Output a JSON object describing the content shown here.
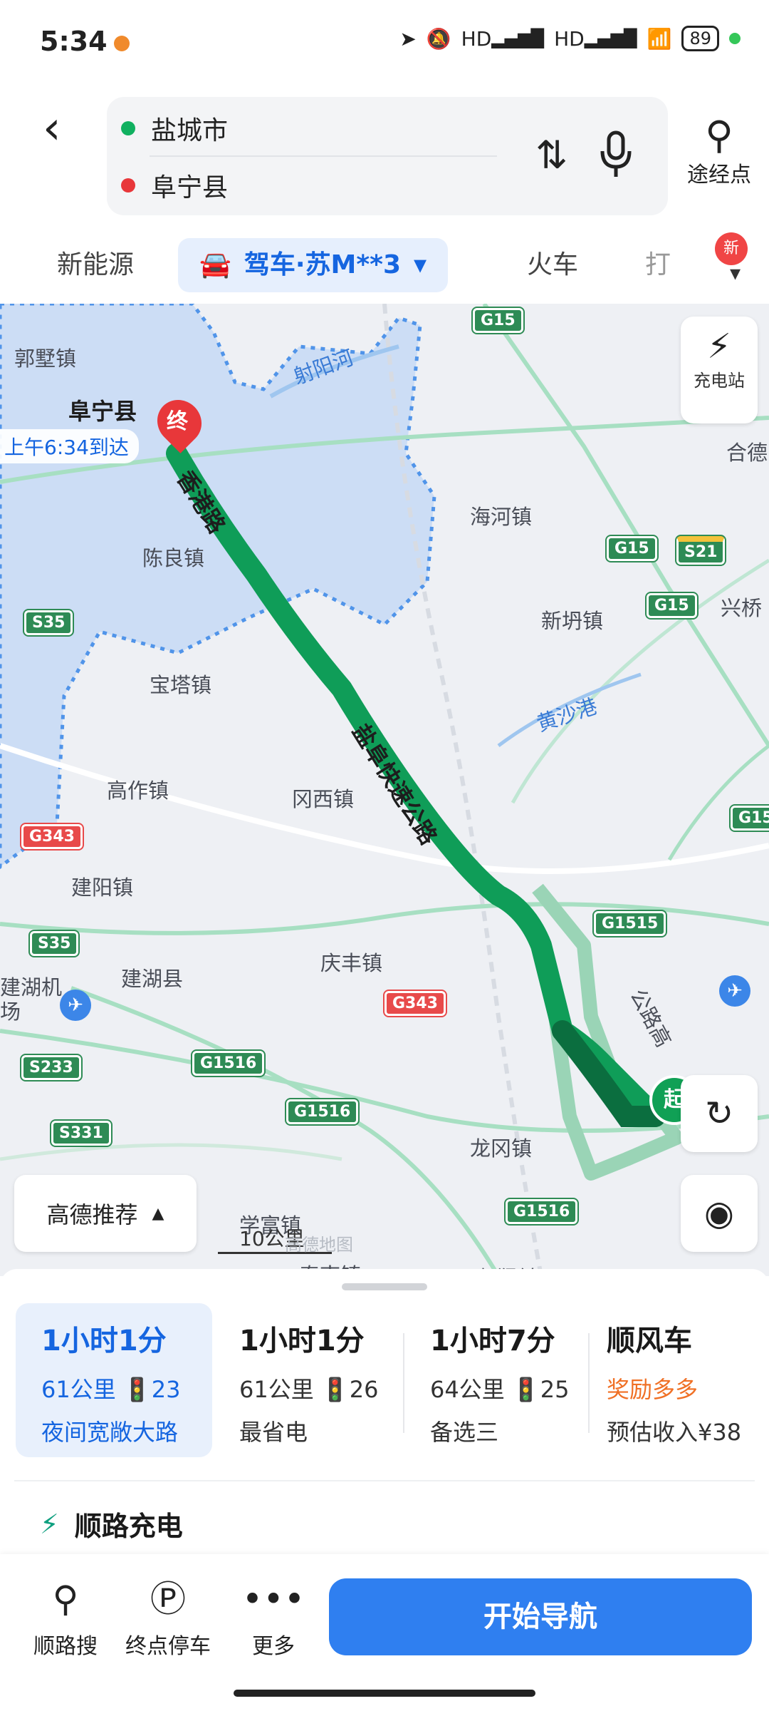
{
  "status_bar": {
    "time": "5:34",
    "battery": "89",
    "signal_labels": [
      "HD",
      "HD"
    ]
  },
  "search": {
    "origin": "盐城市",
    "destination": "阜宁县",
    "waypoint_label": "途经点"
  },
  "modes": {
    "new_energy": "新能源",
    "drive": "驾车·苏M**3",
    "train": "火车",
    "taxi": "打",
    "badge": "新"
  },
  "colors": {
    "accent": "#1565e0",
    "route": "#10a055",
    "origin_dot": "#10b060",
    "destination_dot": "#e8373a",
    "button": "#2f7ff0"
  },
  "map": {
    "destination_name": "阜宁县",
    "arrival": "上午6:34到达",
    "end_pin": "终",
    "start_pin": "起",
    "places": [
      "郭墅镇",
      "陈良镇",
      "海河镇",
      "新坍镇",
      "兴桥",
      "合德",
      "宝塔镇",
      "高作镇",
      "冈西镇",
      "建阳镇",
      "建湖县",
      "庆丰镇",
      "龙冈镇",
      "学富镇",
      "秦南镇",
      "郭猛镇"
    ],
    "airport_label": "建湖机场",
    "rivers": [
      "射阳河",
      "黄沙港"
    ],
    "roads": [
      "香港路",
      "盐阜快速公路",
      "公路高"
    ],
    "shields": [
      "G15",
      "G15",
      "G15",
      "S21",
      "G15",
      "S35",
      "G343",
      "S35",
      "G1515",
      "G343",
      "S233",
      "G1516",
      "G1516",
      "S331",
      "G1516"
    ],
    "charging_button": "充电站",
    "gaode_recommend": "高德推荐",
    "scale": "10公里",
    "watermark": "高德地图"
  },
  "routes": [
    {
      "time": "1小时1分",
      "distance": "61公里",
      "lights": "23",
      "note": "夜间宽敞大路"
    },
    {
      "time": "1小时1分",
      "distance": "61公里",
      "lights": "26",
      "note": "最省电"
    },
    {
      "time": "1小时7分",
      "distance": "64公里",
      "lights": "25",
      "note": "备选三"
    }
  ],
  "carpool": {
    "title": "顺风车",
    "reward": "奖励多多",
    "income": "预估收入¥38"
  },
  "charge_along": "顺路充电",
  "bottom_bar": {
    "search_along": "顺路搜",
    "parking": "终点停车",
    "more": "更多",
    "start_nav": "开始导航"
  }
}
